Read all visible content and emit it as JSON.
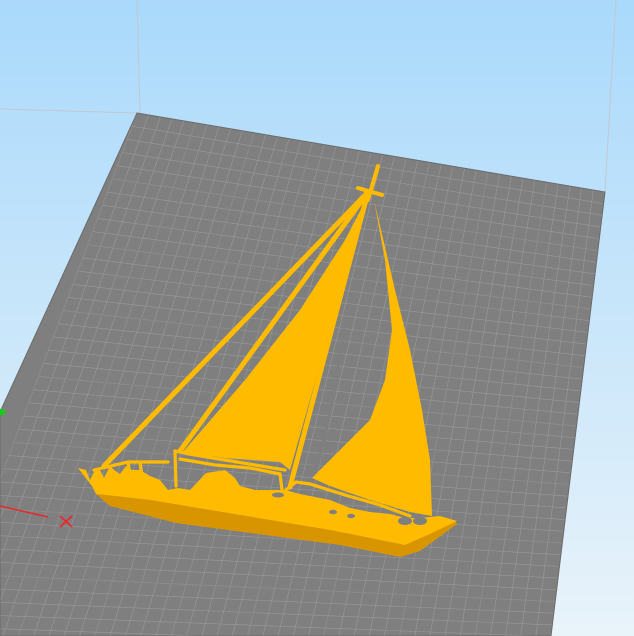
{
  "viewport": {
    "background_top": "#a9d9fb",
    "background_bottom": "#e9f3fa"
  },
  "build_plate": {
    "color": "#7f7f7f",
    "grid_minor_color": "#9a9a9a",
    "grid_major_color": "#8c8c8c",
    "edge_color": "#6a6a6a"
  },
  "model": {
    "color": "#ffbb00",
    "shade_color": "#d99500"
  },
  "axes": {
    "x_color": "#e8282a",
    "y_color": "#1fc41f"
  }
}
